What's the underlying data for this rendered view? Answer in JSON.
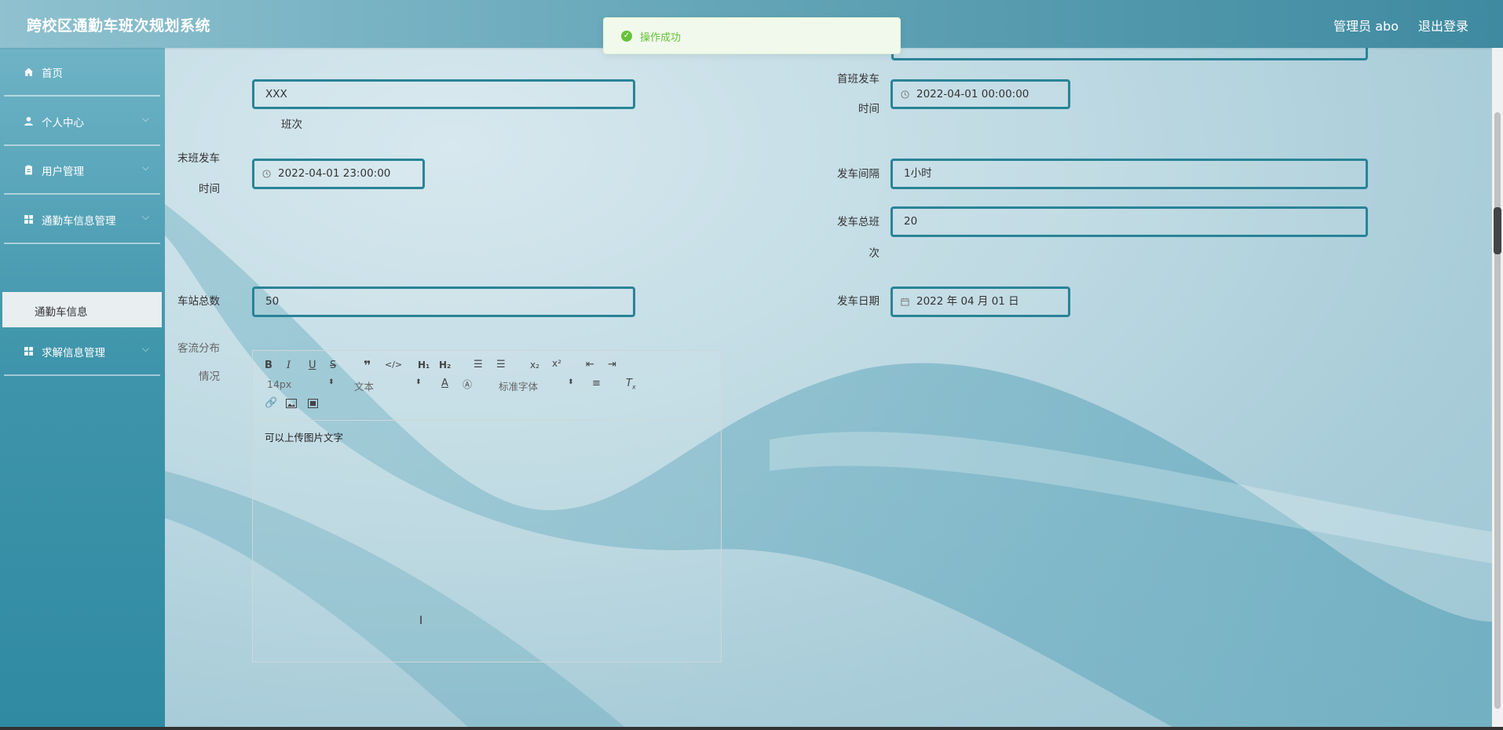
{
  "app": {
    "title": "跨校区通勤车班次规划系统",
    "admin": "管理员 abo",
    "logout": "退出登录"
  },
  "toast": {
    "message": "操作成功"
  },
  "sidebar": {
    "items": [
      {
        "label": "首页",
        "icon": "home-icon"
      },
      {
        "label": "个人中心",
        "icon": "user-icon"
      },
      {
        "label": "用户管理",
        "icon": "clipboard-icon"
      },
      {
        "label": "通勤车信息管理",
        "icon": "grid-icon"
      },
      {
        "label": "求解信息管理",
        "icon": "grid-icon"
      }
    ],
    "submenu": "通勤车信息"
  },
  "form": {
    "banci_label": "班次",
    "banci_value": "XXX",
    "first_label_1": "首班发车",
    "first_label_2": "时间",
    "first_value": "2022-04-01 00:00:00",
    "last_label_1": "末班发车",
    "last_label_2": "时间",
    "last_value": "2022-04-01 23:00:00",
    "interval_label": "发车间隔",
    "interval_value": "1小时",
    "total_label_1": "发车总班",
    "total_label_2": "次",
    "total_value": "20",
    "stations_label": "车站总数",
    "stations_value": "50",
    "date_label": "发车日期",
    "date_value": "2022 年 04 月 01 日",
    "flow_label_1": "客流分布",
    "flow_label_2": "情况"
  },
  "editor": {
    "font_size": "14px",
    "text_type": "文本",
    "font_family": "标准字体",
    "content": "可以上传图片文字"
  },
  "colors": {
    "accent": "#2a8397",
    "success": "#67c23a"
  }
}
